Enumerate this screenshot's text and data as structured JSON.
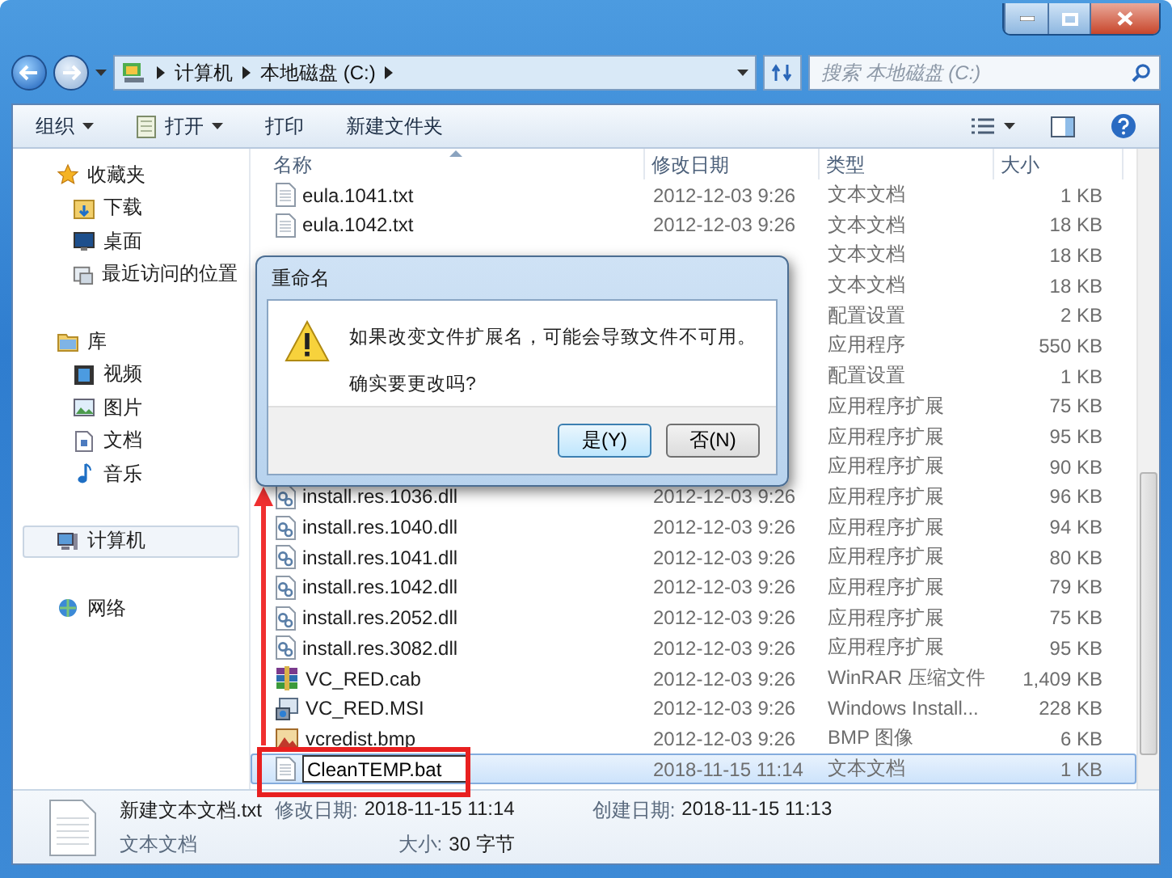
{
  "address": {
    "crumbs": [
      "计算机",
      "本地磁盘 (C:)"
    ]
  },
  "search": {
    "placeholder": "搜索 本地磁盘 (C:)"
  },
  "toolbar": {
    "items": [
      {
        "label": "组织",
        "dropdown": true,
        "kind": "plain"
      },
      {
        "label": "打开",
        "dropdown": true,
        "kind": "open"
      },
      {
        "label": "打印",
        "dropdown": false,
        "kind": "plain"
      },
      {
        "label": "新建文件夹",
        "dropdown": false,
        "kind": "plain"
      }
    ]
  },
  "sidebar": {
    "groups": [
      {
        "label": "收藏夹",
        "kind": "star",
        "selected": false,
        "children": [
          {
            "label": "下载",
            "kind": "download",
            "selected": false
          },
          {
            "label": "桌面",
            "kind": "desktop",
            "selected": false
          },
          {
            "label": "最近访问的位置",
            "kind": "recent",
            "selected": false
          }
        ]
      },
      {
        "label": "库",
        "kind": "library",
        "selected": false,
        "children": [
          {
            "label": "视频",
            "kind": "video",
            "selected": false
          },
          {
            "label": "图片",
            "kind": "picture",
            "selected": false
          },
          {
            "label": "文档",
            "kind": "doc",
            "selected": false
          },
          {
            "label": "音乐",
            "kind": "music",
            "selected": false
          }
        ]
      },
      {
        "label": "计算机",
        "kind": "computer",
        "selected": true
      },
      {
        "label": "网络",
        "kind": "network",
        "selected": false
      }
    ]
  },
  "table": {
    "columns": [
      "名称",
      "修改日期",
      "类型",
      "大小"
    ],
    "rows": [
      {
        "kind": "txt",
        "name": "eula.1041.txt",
        "date": "2012-12-03 9:26",
        "type": "文本文档",
        "size": "1 KB",
        "selected": false
      },
      {
        "kind": "txt",
        "name": "eula.1042.txt",
        "date": "2012-12-03 9:26",
        "type": "文本文档",
        "size": "18 KB",
        "selected": false
      },
      {
        "type": "文本文档",
        "size": "18 KB",
        "selected": false
      },
      {
        "type": "文本文档",
        "size": "18 KB",
        "selected": false
      },
      {
        "type": "配置设置",
        "size": "2 KB",
        "selected": false
      },
      {
        "type": "应用程序",
        "size": "550 KB",
        "selected": false
      },
      {
        "type": "配置设置",
        "size": "1 KB",
        "selected": false
      },
      {
        "type": "应用程序扩展",
        "size": "75 KB",
        "selected": false
      },
      {
        "type": "应用程序扩展",
        "size": "95 KB",
        "selected": false
      },
      {
        "type": "应用程序扩展",
        "size": "90 KB",
        "selected": false
      },
      {
        "kind": "dll",
        "name": "install.res.1036.dll",
        "date": "2012-12-03 9:26",
        "type": "应用程序扩展",
        "size": "96 KB",
        "selected": false
      },
      {
        "kind": "dll",
        "name": "install.res.1040.dll",
        "date": "2012-12-03 9:26",
        "type": "应用程序扩展",
        "size": "94 KB",
        "selected": false
      },
      {
        "kind": "dll",
        "name": "install.res.1041.dll",
        "date": "2012-12-03 9:26",
        "type": "应用程序扩展",
        "size": "80 KB",
        "selected": false
      },
      {
        "kind": "dll",
        "name": "install.res.1042.dll",
        "date": "2012-12-03 9:26",
        "type": "应用程序扩展",
        "size": "79 KB",
        "selected": false
      },
      {
        "kind": "dll",
        "name": "install.res.2052.dll",
        "date": "2012-12-03 9:26",
        "type": "应用程序扩展",
        "size": "75 KB",
        "selected": false
      },
      {
        "kind": "dll",
        "name": "install.res.3082.dll",
        "date": "2012-12-03 9:26",
        "type": "应用程序扩展",
        "size": "95 KB",
        "selected": false
      },
      {
        "kind": "cab",
        "name": "VC_RED.cab",
        "date": "2012-12-03 9:26",
        "type": "WinRAR 压缩文件",
        "size": "1,409 KB",
        "selected": false
      },
      {
        "kind": "msi",
        "name": "VC_RED.MSI",
        "date": "2012-12-03 9:26",
        "type": "Windows Install...",
        "size": "228 KB",
        "selected": false
      },
      {
        "kind": "bmp",
        "name": "vcredist.bmp",
        "date": "2012-12-03 9:26",
        "type": "BMP 图像",
        "size": "6 KB",
        "selected": false
      },
      {
        "kind": "txt",
        "name": "CleanTEMP.bat",
        "date": "2018-11-15 11:14",
        "type": "文本文档",
        "size": "1 KB",
        "selected": true,
        "editing": true
      }
    ]
  },
  "details": {
    "name": "新建文本文档.txt",
    "type": "文本文档",
    "fields": [
      {
        "label": "修改日期:",
        "value": "2018-11-15 11:14"
      },
      {
        "label": "大小:",
        "value": "30 字节"
      },
      {
        "label": "创建日期:",
        "value": "2018-11-15 11:13"
      }
    ]
  },
  "dialog": {
    "title": "重命名",
    "message": "如果改变文件扩展名，可能会导致文件不可用。",
    "question": "确实要更改吗?",
    "buttons": [
      {
        "label": "是(Y)",
        "default": true
      },
      {
        "label": "否(N)",
        "default": false
      }
    ]
  }
}
